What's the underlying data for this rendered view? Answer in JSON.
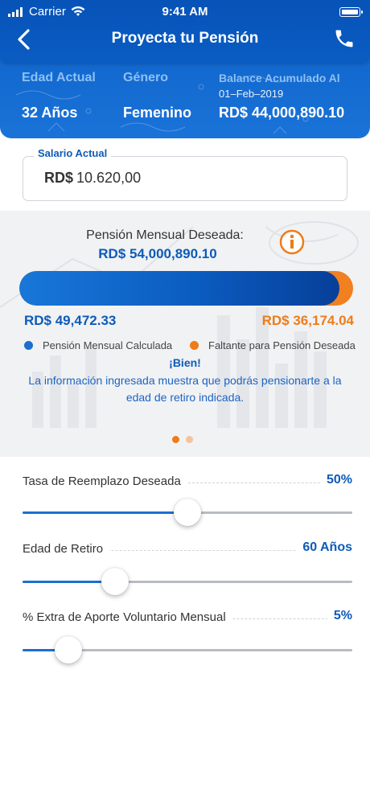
{
  "status_bar": {
    "carrier": "Carrier",
    "time": "9:41 AM"
  },
  "nav": {
    "title": "Proyecta tu Pensión",
    "back_icon": "chevron-left-icon",
    "call_icon": "phone-icon"
  },
  "summary": {
    "age_label": "Edad Actual",
    "age_value": "32 Años",
    "gender_label": "Género",
    "gender_value": "Femenino",
    "balance_label": "Balance Acumulado Al",
    "balance_date": "01–Feb–2019",
    "balance_value": "RD$ 44,000,890.10"
  },
  "salary": {
    "label": "Salario Actual",
    "currency": "RD$",
    "value": "10.620,00"
  },
  "pension_card": {
    "desired_label": "Pensión Mensual Deseada:",
    "desired_value": "RD$ 54,000,890.10",
    "calculated_value": "RD$ 49,472.33",
    "missing_value": "RD$ 36,174.04",
    "calculated_fraction": 0.96,
    "legend_calculated": "Pensión Mensual Calculada",
    "legend_missing": "Faltante para Pensión Deseada",
    "result_title": "¡Bien!",
    "result_message": "La información ingresada muestra que podrás pensionarte a la edad de retiro indicada.",
    "page_count": 2,
    "active_page": 1
  },
  "sliders": [
    {
      "label": "Tasa de Reemplazo Deseada",
      "value": "50%",
      "fraction": 0.5
    },
    {
      "label": "Edad de Retiro",
      "value": "60 Años",
      "fraction": 0.28
    },
    {
      "label": "% Extra de Aporte Voluntario Mensual",
      "value": "5%",
      "fraction": 0.14
    }
  ],
  "colors": {
    "brand_blue": "#0d5bb8",
    "header_blue": "#0a5cc3",
    "accent_orange": "#ee7c1a",
    "track_fill": "#1b6fd0",
    "label_light_blue": "#8ec0f4"
  }
}
